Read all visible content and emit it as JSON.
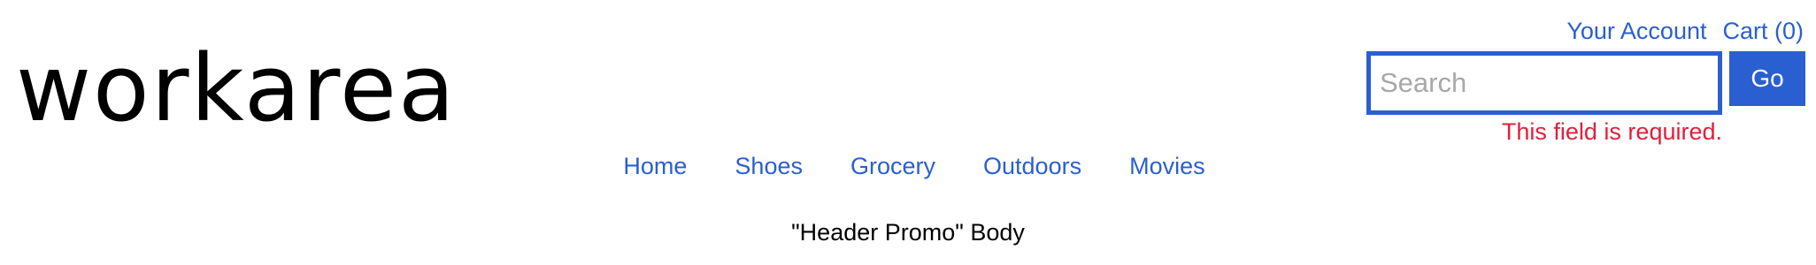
{
  "logo": {
    "text": "workarea"
  },
  "account_links": {
    "your_account": "Your Account",
    "cart": "Cart (0)"
  },
  "search": {
    "placeholder": "Search",
    "value": "",
    "go_label": "Go",
    "error": "This field is required."
  },
  "nav": {
    "items": [
      {
        "label": "Home"
      },
      {
        "label": "Shoes"
      },
      {
        "label": "Grocery"
      },
      {
        "label": "Outdoors"
      },
      {
        "label": "Movies"
      }
    ]
  },
  "promo": {
    "body": "\"Header Promo\" Body"
  },
  "colors": {
    "accent": "#2a5fd1",
    "error": "#e0203b",
    "text": "#000000"
  }
}
